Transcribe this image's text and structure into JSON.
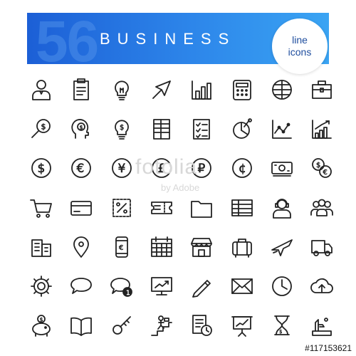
{
  "banner": {
    "count": "56",
    "title": "BUSINESS",
    "badge_line1": "line",
    "badge_line2": "icons"
  },
  "watermark": {
    "brand": "fotolia",
    "sub": "by Adobe"
  },
  "stock_id": "#117153621",
  "colors": {
    "icon_stroke": "#222222",
    "banner_start": "#1c5fd6",
    "banner_end": "#3aa4f3",
    "badge_text": "#1e4d9e"
  },
  "icons": [
    "businessman-icon",
    "clipboard-icon",
    "lightbulb-icon",
    "cursor-arrow-icon",
    "bar-chart-icon",
    "calculator-icon",
    "globe-icon",
    "briefcase-icon",
    "search-dollar-icon",
    "head-dollar-icon",
    "bulb-dollar-icon",
    "ledger-table-icon",
    "checklist-icon",
    "pie-chart-icon",
    "line-chart-icon",
    "growth-chart-icon",
    "dollar-coin-icon",
    "euro-coin-icon",
    "yen-coin-icon",
    "pound-coin-icon",
    "ruble-coin-icon",
    "cent-coin-icon",
    "banknote-icon",
    "coins-exchange-icon",
    "shopping-cart-icon",
    "credit-card-icon",
    "discount-coupon-icon",
    "ticket-icon",
    "folder-icon",
    "spreadsheet-icon",
    "support-agent-icon",
    "team-icon",
    "office-building-icon",
    "location-pin-icon",
    "mobile-payment-icon",
    "calendar-icon",
    "storefront-icon",
    "luggage-icon",
    "airplane-icon",
    "delivery-van-icon",
    "settings-gear-icon",
    "chat-bubble-icon",
    "message-notification-icon",
    "presentation-monitor-icon",
    "pencil-icon",
    "envelope-icon",
    "clock-icon",
    "cloud-upload-icon",
    "piggy-bank-icon",
    "open-book-icon",
    "key-icon",
    "career-ladder-icon",
    "schedule-document-icon",
    "presentation-board-icon",
    "hourglass-money-icon",
    "award-hand-icon"
  ]
}
